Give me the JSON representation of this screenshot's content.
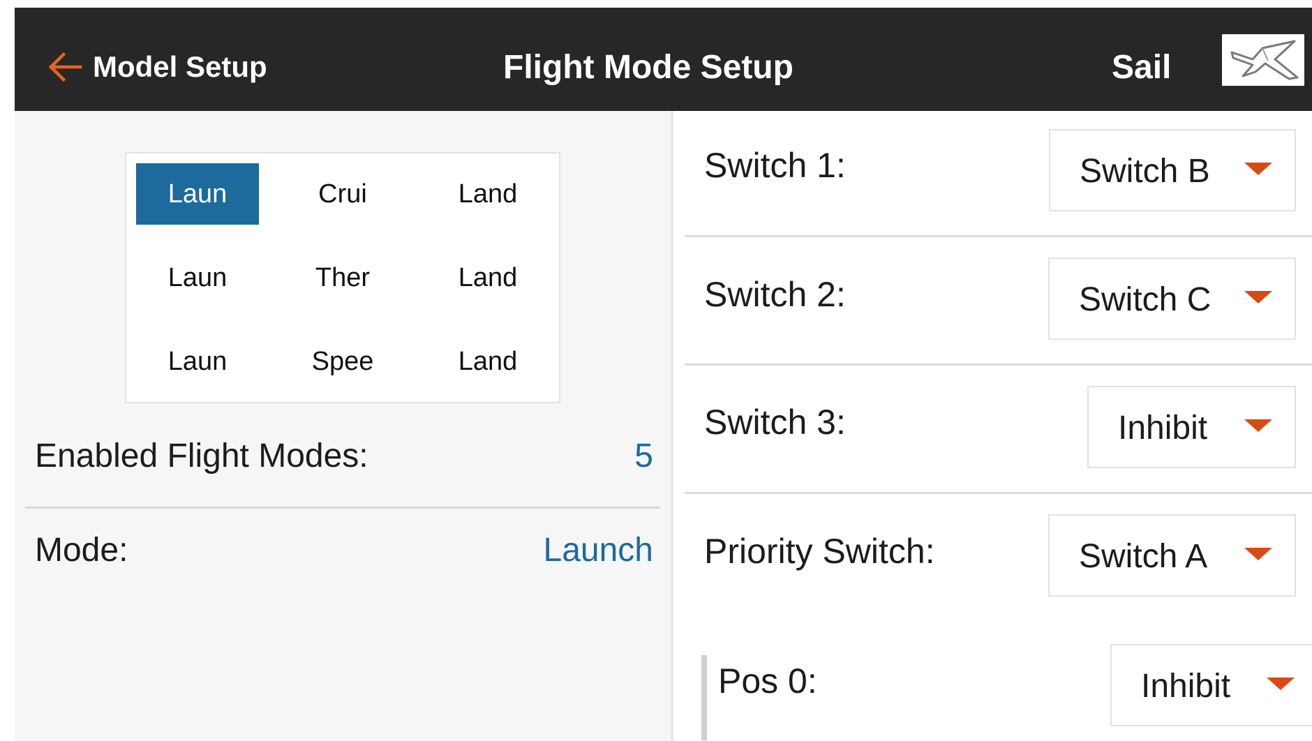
{
  "header": {
    "back_label": "Model Setup",
    "title": "Flight Mode Setup",
    "model_name": "Sail"
  },
  "mode_grid": {
    "rows": [
      [
        "Laun",
        "Crui",
        "Land"
      ],
      [
        "Laun",
        "Ther",
        "Land"
      ],
      [
        "Laun",
        "Spee",
        "Land"
      ]
    ],
    "selected": "Laun"
  },
  "info": {
    "enabled_label": "Enabled Flight Modes:",
    "enabled_value": "5",
    "mode_label": "Mode:",
    "mode_value": "Launch"
  },
  "switches": [
    {
      "label": "Switch 1:",
      "value": "Switch B"
    },
    {
      "label": "Switch 2:",
      "value": "Switch C"
    },
    {
      "label": "Switch 3:",
      "value": "Inhibit"
    },
    {
      "label": "Priority Switch:",
      "value": "Switch A"
    },
    {
      "label": "Pos 0:",
      "value": "Inhibit"
    }
  ],
  "colors": {
    "header_bg": "#272727",
    "accent_blue": "#1d6a9c",
    "back_arrow": "#e8661f",
    "caret": "#d84a14"
  },
  "icons": {
    "back": "arrow-left-icon",
    "model": "sailplane-icon",
    "dropdown": "caret-down-icon"
  }
}
